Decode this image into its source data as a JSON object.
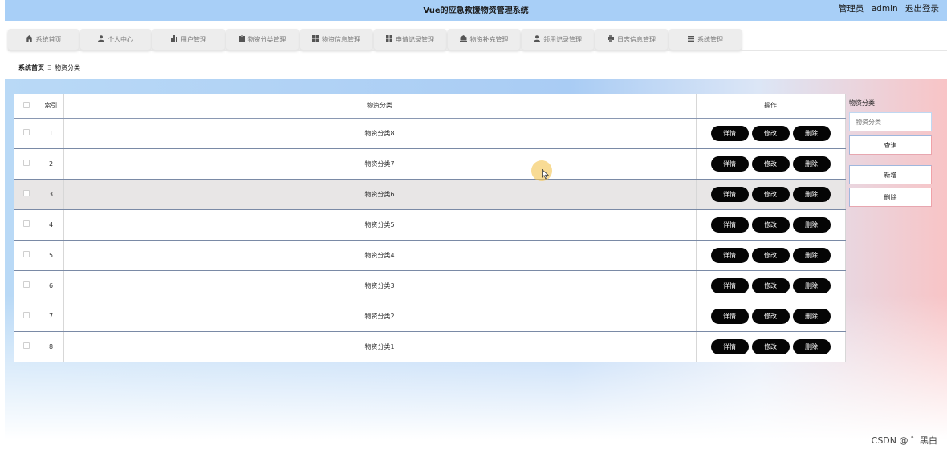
{
  "header": {
    "title": "Vue的应急救援物资管理系统",
    "user_role": "管理员",
    "username": "admin",
    "logout": "退出登录"
  },
  "nav": [
    {
      "label": "系统首页",
      "icon": "home-icon"
    },
    {
      "label": "个人中心",
      "icon": "user-icon"
    },
    {
      "label": "用户管理",
      "icon": "chart-icon"
    },
    {
      "label": "物资分类管理",
      "icon": "clipboard-icon"
    },
    {
      "label": "物资信息管理",
      "icon": "grid-icon"
    },
    {
      "label": "申请记录管理",
      "icon": "grid-icon"
    },
    {
      "label": "物资补充管理",
      "icon": "bank-icon"
    },
    {
      "label": "领用记录管理",
      "icon": "user-icon"
    },
    {
      "label": "日志信息管理",
      "icon": "print-icon"
    },
    {
      "label": "系统管理",
      "icon": "menu-icon"
    }
  ],
  "breadcrumb": {
    "home": "系统首页",
    "current": "物资分类"
  },
  "table": {
    "headers": {
      "index": "索引",
      "category": "物资分类",
      "actions": "操作"
    },
    "actions": {
      "detail": "详情",
      "edit": "修改",
      "delete": "删除"
    },
    "rows": [
      {
        "index": "1",
        "category": "物资分类8"
      },
      {
        "index": "2",
        "category": "物资分类7"
      },
      {
        "index": "3",
        "category": "物资分类6"
      },
      {
        "index": "4",
        "category": "物资分类5"
      },
      {
        "index": "5",
        "category": "物资分类4"
      },
      {
        "index": "6",
        "category": "物资分类3"
      },
      {
        "index": "7",
        "category": "物资分类2"
      },
      {
        "index": "8",
        "category": "物资分类1"
      }
    ],
    "highlighted_row": 3
  },
  "side": {
    "label": "物资分类",
    "placeholder": "物资分类",
    "search": "查询",
    "add": "新增",
    "delete": "删除"
  },
  "watermark": "CSDN @ ゛黑白",
  "colors": {
    "topbar": "#a8cff7",
    "button": "#050505",
    "highlight_row": "#e8e6e6"
  }
}
